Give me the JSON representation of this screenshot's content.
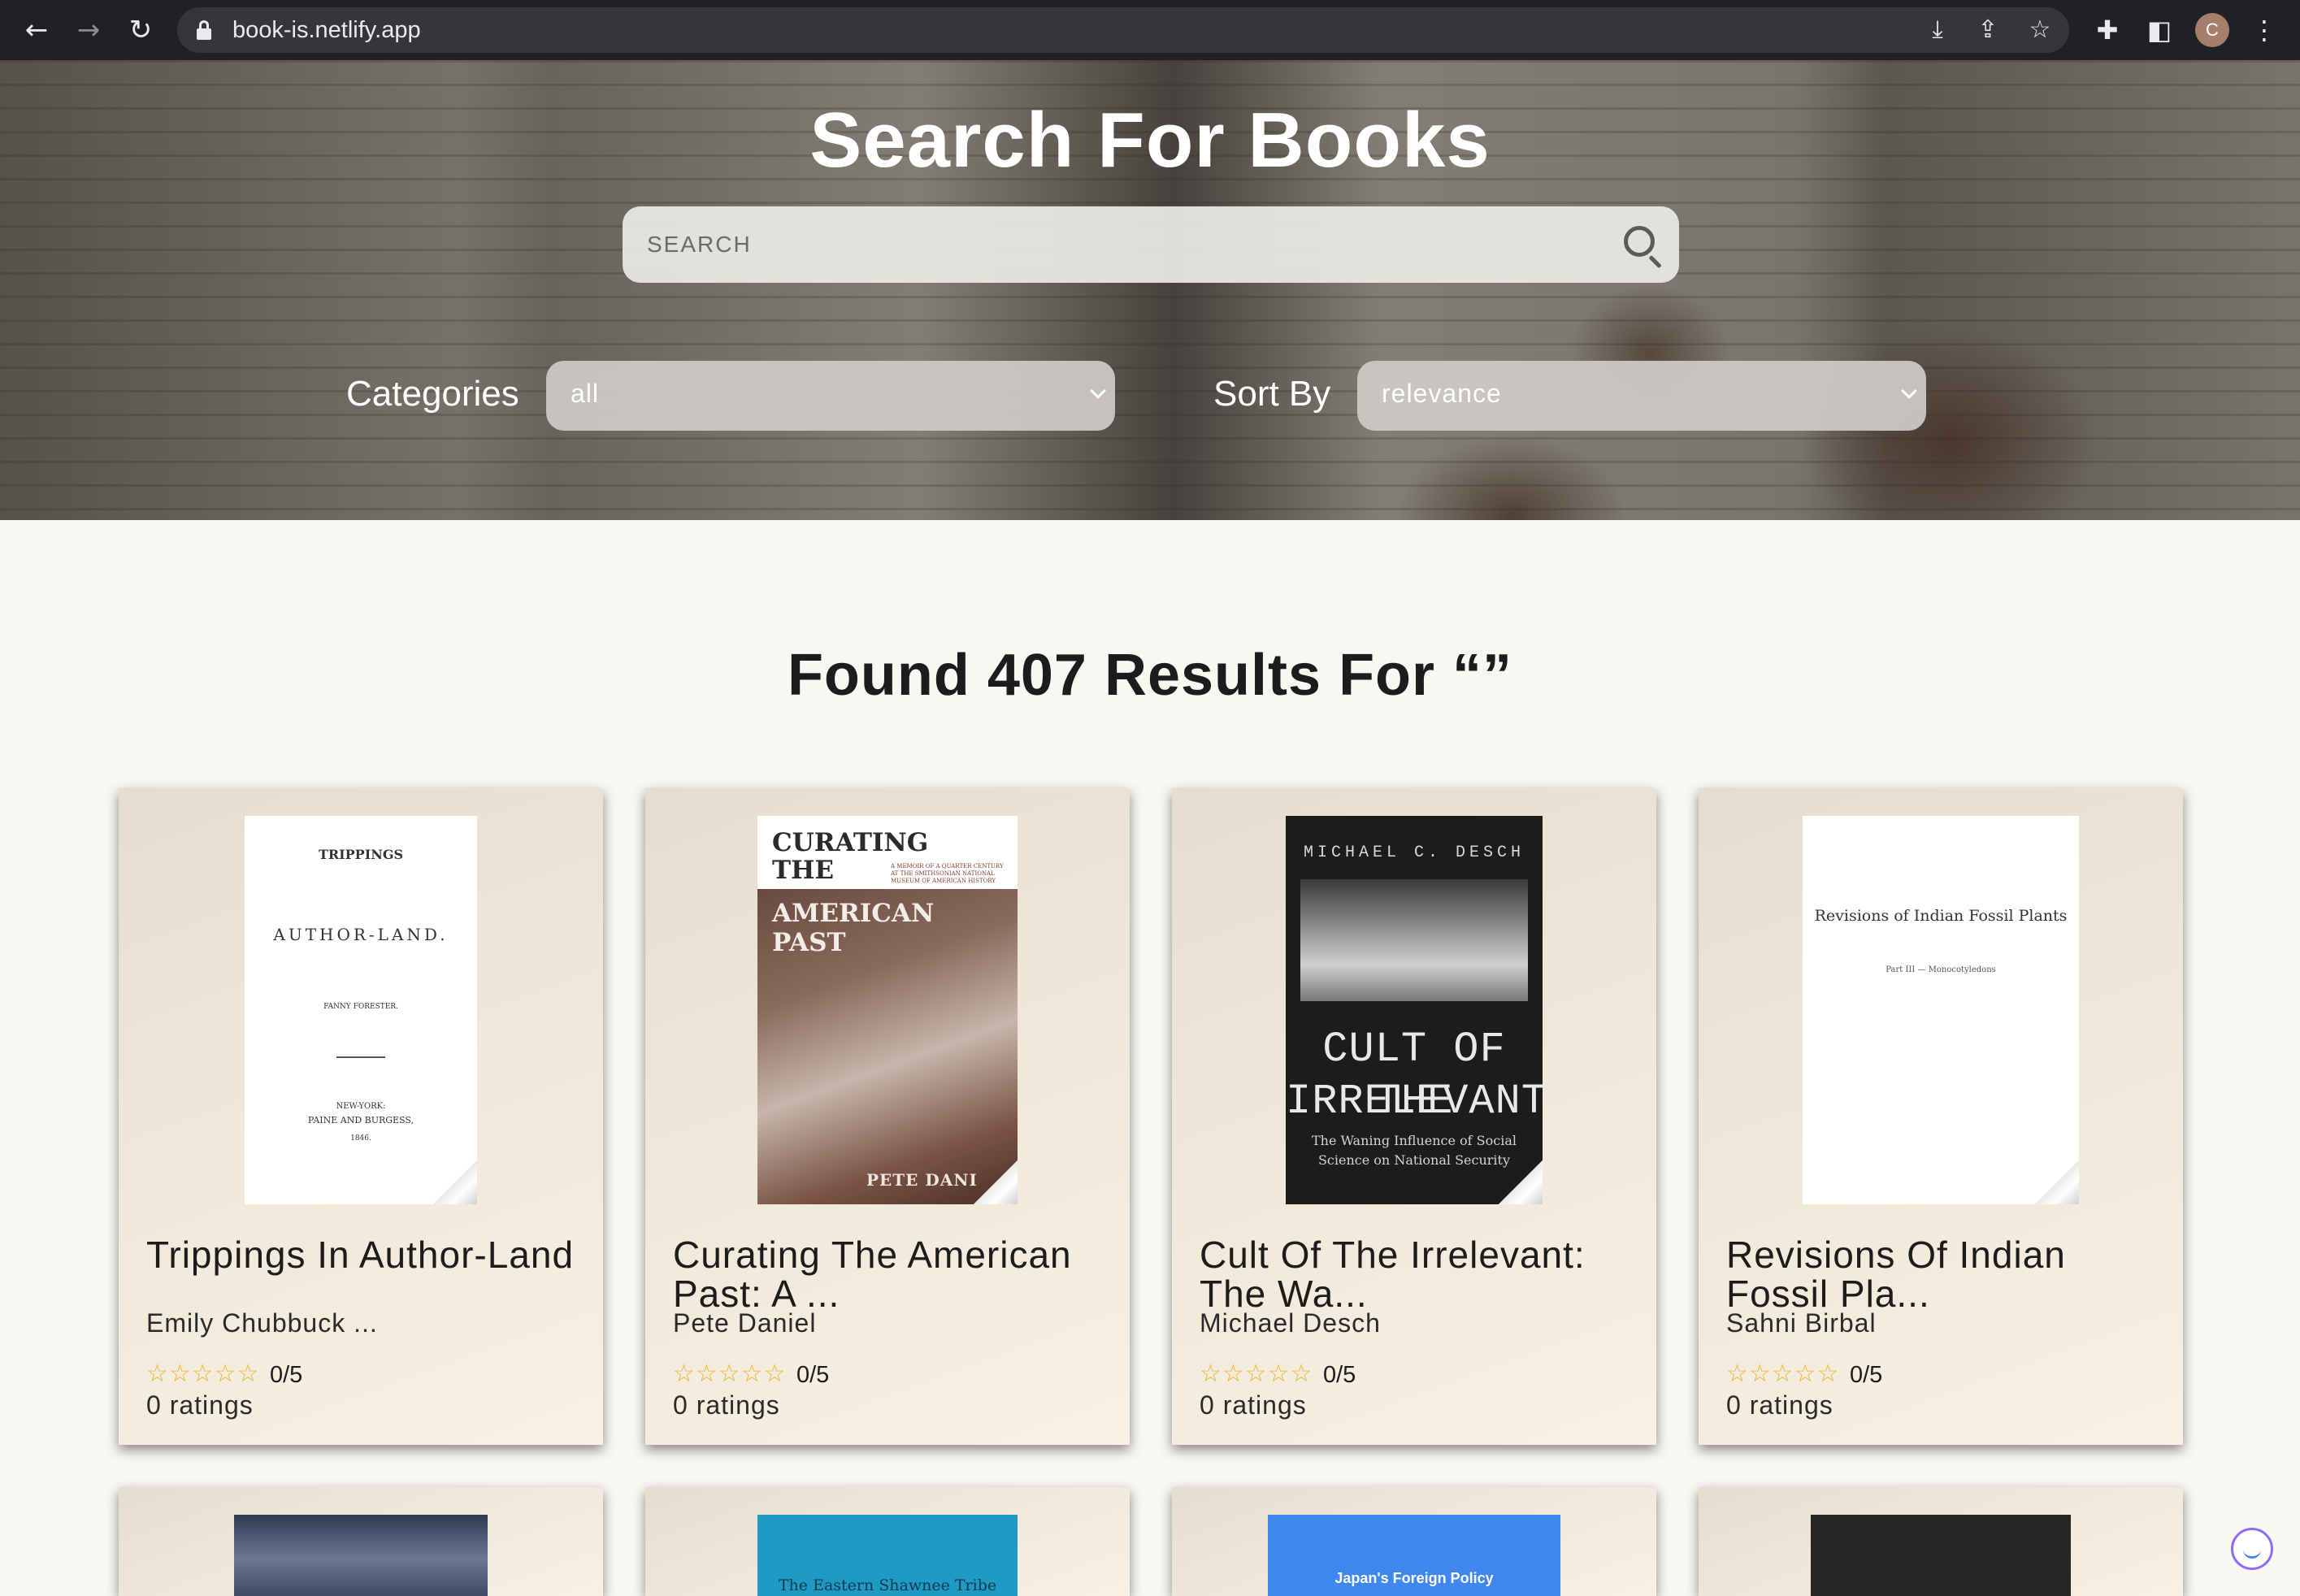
{
  "browser": {
    "url": "book-is.netlify.app",
    "profile_initial": "C",
    "icons": [
      "back-icon",
      "forward-icon",
      "reload-icon",
      "lock-icon",
      "install-icon",
      "share-icon",
      "star-icon",
      "extensions-icon",
      "sidepanel-icon",
      "menu-icon"
    ]
  },
  "hero": {
    "title": "Search For Books",
    "search_placeholder": "SEARCH",
    "categories_label": "Categories",
    "categories_value": "all",
    "sort_label": "Sort By",
    "sort_value": "relevance"
  },
  "results": {
    "heading": "Found 407 Results For “”"
  },
  "books": [
    {
      "title": "Trippings In Author-Land",
      "author": "Emily Chubbuck ...",
      "stars": "☆☆☆☆☆",
      "rating": "0/5",
      "ratings_count": "0 ratings",
      "cover_text": [
        "TRIPPINGS",
        "AUTHOR-LAND.",
        "FANNY FORESTER.",
        "NEW-YORK:",
        "PAINE AND BURGESS,",
        "1846."
      ]
    },
    {
      "title": "Curating The American Past: A ...",
      "author": "Pete Daniel",
      "stars": "☆☆☆☆☆",
      "rating": "0/5",
      "ratings_count": "0 ratings",
      "cover_text": [
        "CURATING THE",
        "AMERICAN PAST",
        "A MEMOIR OF A QUARTER CENTURY AT THE SMITHSONIAN NATIONAL MUSEUM OF AMERICAN HISTORY",
        "PETE DANI"
      ]
    },
    {
      "title": "Cult Of The Irrelevant: The Wa...",
      "author": "Michael Desch",
      "stars": "☆☆☆☆☆",
      "rating": "0/5",
      "ratings_count": "0 ratings",
      "cover_text": [
        "MICHAEL C. DESCH",
        "CULT OF THE",
        "IRRELEVANT",
        "The Waning Influence of Social",
        "Science on National Security"
      ]
    },
    {
      "title": "Revisions Of Indian Fossil Pla...",
      "author": "Sahni Birbal",
      "stars": "☆☆☆☆☆",
      "rating": "0/5",
      "ratings_count": "0 ratings",
      "cover_text": [
        "Revisions of Indian Fossil Plants",
        "Part III — Monocotyledons"
      ]
    }
  ],
  "next_row_covers": [
    {
      "cover_text": ""
    },
    {
      "cover_text": "The Eastern Shawnee Tribe"
    },
    {
      "cover_text": "Japan's Foreign Policy"
    },
    {
      "cover_text": ""
    }
  ],
  "colors": {
    "chrome": "#202124",
    "star": "#e8b330",
    "page_bg": "#f8f7f4",
    "card_bg": "#efe7d8"
  }
}
